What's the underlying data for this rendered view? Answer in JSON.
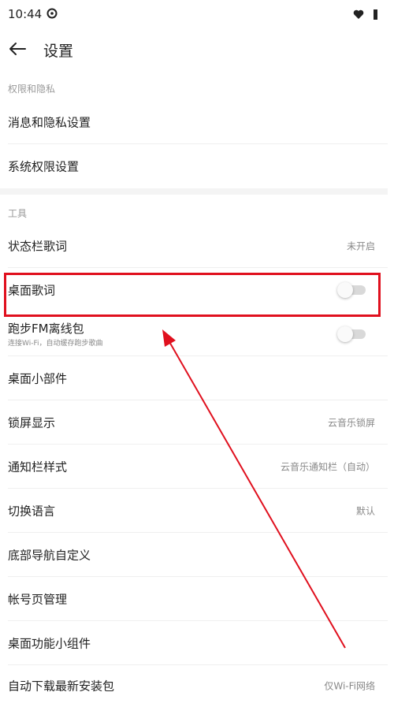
{
  "status_bar": {
    "time": "10:44",
    "app_icon": "netease-music-icon",
    "right_icons": [
      "heart-icon",
      "signal-icon"
    ]
  },
  "header": {
    "back_icon": "back-arrow-icon",
    "title": "设置"
  },
  "sections": [
    {
      "label": "权限和隐私",
      "items": [
        {
          "label": "消息和隐私设置"
        },
        {
          "label": "系统权限设置"
        }
      ]
    },
    {
      "label": "工具",
      "items": [
        {
          "label": "状态栏歌词",
          "value": "未开启"
        },
        {
          "label": "桌面歌词",
          "toggle": false
        },
        {
          "label": "跑步FM离线包",
          "sublabel": "连接Wi-Fi，自动缓存跑步歌曲",
          "toggle": false
        },
        {
          "label": "桌面小部件"
        },
        {
          "label": "锁屏显示",
          "value": "云音乐锁屏"
        },
        {
          "label": "通知栏样式",
          "value": "云音乐通知栏（自动）"
        },
        {
          "label": "切换语言",
          "value": "默认"
        },
        {
          "label": "底部导航自定义"
        },
        {
          "label": "帐号页管理"
        },
        {
          "label": "桌面功能小组件"
        },
        {
          "label": "自动下载最新安装包",
          "value": "仅Wi-Fi网络"
        }
      ]
    }
  ],
  "colors": {
    "annotation": "#e0101e",
    "toggle_off": "#d9d9d9"
  }
}
